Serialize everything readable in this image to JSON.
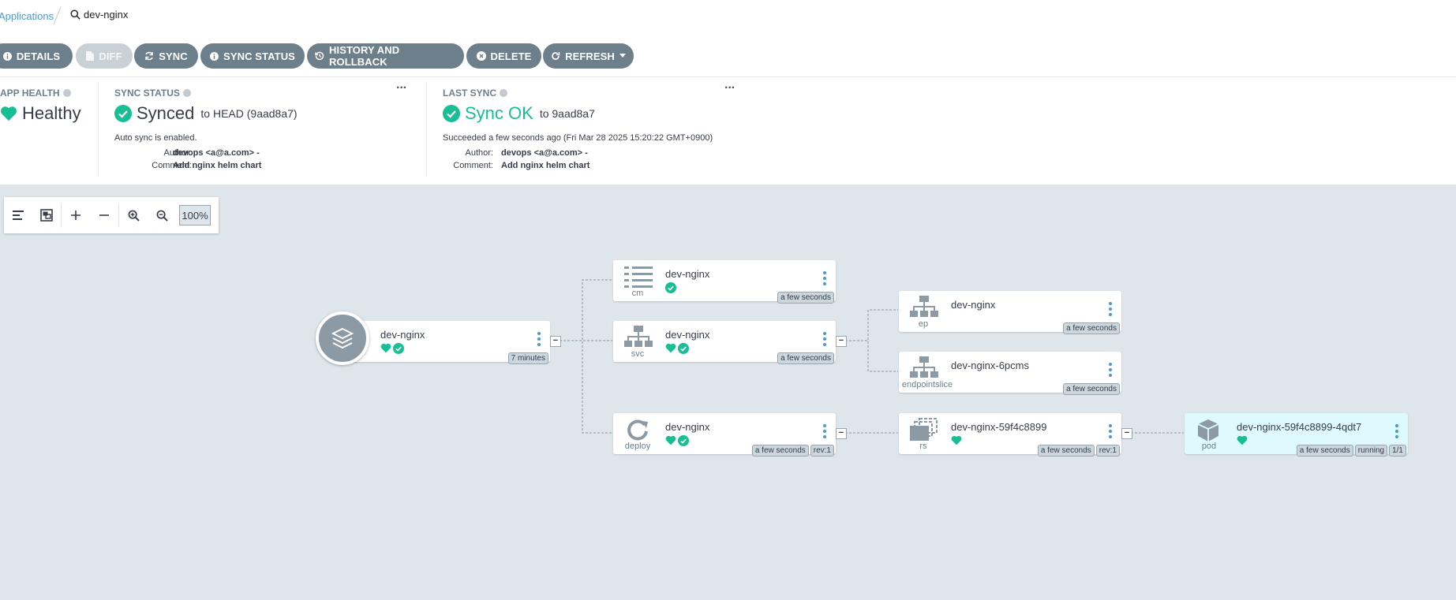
{
  "breadcrumb": {
    "applications": "Applications",
    "current": "dev-nginx"
  },
  "toolbar": {
    "details": "DETAILS",
    "diff": "DIFF",
    "sync": "SYNC",
    "sync_status": "SYNC STATUS",
    "history": "HISTORY AND ROLLBACK",
    "delete": "DELETE",
    "refresh": "REFRESH"
  },
  "app_health": {
    "label": "APP HEALTH",
    "value": "Healthy"
  },
  "sync_status": {
    "label": "SYNC STATUS",
    "value": "Synced",
    "target": "to HEAD (9aad8a7)",
    "auto": "Auto sync is enabled.",
    "author_label": "Author:",
    "author": "devops <a@a.com> -",
    "comment_label": "Comment:",
    "comment": "Add nginx helm chart"
  },
  "last_sync": {
    "label": "LAST SYNC",
    "value": "Sync OK",
    "target": "to 9aad8a7",
    "succeeded": "Succeeded a few seconds ago (Fri Mar 28 2025 15:20:22 GMT+0900)",
    "author_label": "Author:",
    "author": "devops <a@a.com> -",
    "comment_label": "Comment:",
    "comment": "Add nginx helm chart"
  },
  "zoom": {
    "level": "100%"
  },
  "nodes": {
    "app": {
      "name": "dev-nginx",
      "age": "7 minutes"
    },
    "cm": {
      "name": "dev-nginx",
      "kind": "cm",
      "age": "a few seconds"
    },
    "svc": {
      "name": "dev-nginx",
      "kind": "svc",
      "age": "a few seconds"
    },
    "deploy": {
      "name": "dev-nginx",
      "kind": "deploy",
      "age": "a few seconds",
      "rev": "rev:1"
    },
    "ep": {
      "name": "dev-nginx",
      "kind": "ep",
      "age": "a few seconds"
    },
    "eps": {
      "name": "dev-nginx-6pcms",
      "kind": "endpointslice",
      "age": "a few seconds"
    },
    "rs": {
      "name": "dev-nginx-59f4c8899",
      "kind": "rs",
      "age": "a few seconds",
      "rev": "rev:1"
    },
    "pod": {
      "name": "dev-nginx-59f4c8899-4qdt7",
      "kind": "pod",
      "age": "a few seconds",
      "status": "running",
      "ready": "1/1"
    }
  },
  "colors": {
    "healthy": "#18be94",
    "link": "#4a9bc9",
    "button": "#6d7f8b",
    "canvas": "#dee6eb"
  }
}
